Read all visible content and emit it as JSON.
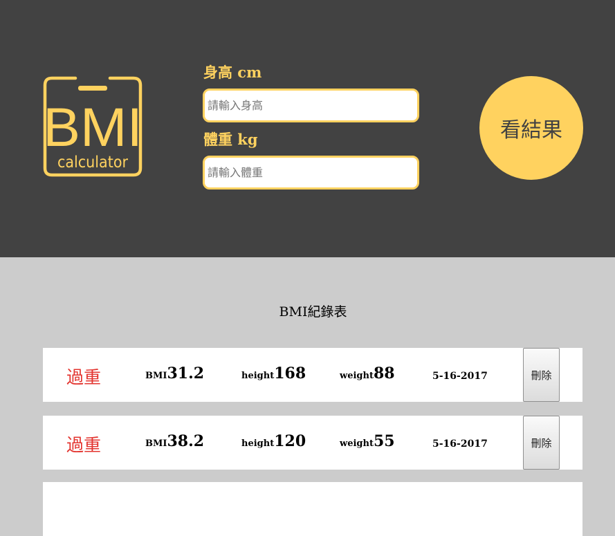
{
  "app": {
    "logo": {
      "text_main": "BMI",
      "text_sub": "calculator",
      "color": "#ffd25f"
    },
    "form": {
      "height_label": "身高 cm",
      "height_placeholder": "請輸入身高",
      "weight_label": "體重 kg",
      "weight_placeholder": "請輸入體重",
      "submit_label": "看結果"
    }
  },
  "records": {
    "title": "BMI紀錄表",
    "items": [
      {
        "status": "過重",
        "bmi_label": "BMI",
        "bmi": "31.2",
        "height_label": "height",
        "height": "168",
        "weight_label": "weight",
        "weight": "88",
        "date": "5-16-2017",
        "delete_label": "刪除"
      },
      {
        "status": "過重",
        "bmi_label": "BMI",
        "bmi": "38.2",
        "height_label": "height",
        "height": "120",
        "weight_label": "weight",
        "weight": "55",
        "date": "5-16-2017",
        "delete_label": "刪除"
      }
    ]
  },
  "colors": {
    "header_bg": "#424242",
    "accent": "#ffd25f",
    "body_bg": "#cccccc",
    "status_overweight": "#e3342f"
  }
}
